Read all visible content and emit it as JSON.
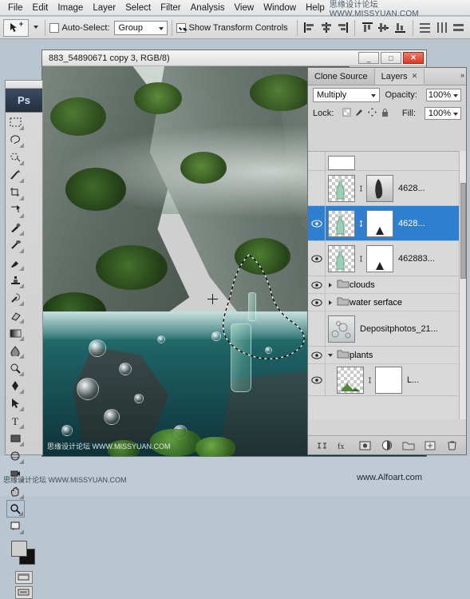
{
  "menubar": {
    "items": [
      "File",
      "Edit",
      "Image",
      "Layer",
      "Select",
      "Filter",
      "Analysis",
      "View",
      "Window",
      "Help"
    ],
    "watermark": "思缘设计论坛 WWW.MISSYUAN.COM"
  },
  "optionsbar": {
    "tool_icon": "move-tool-icon",
    "auto_select_label": "Auto-Select:",
    "auto_select_value": "Group",
    "show_transform_label": "Show Transform Controls",
    "align_icons": [
      "align-left-edges-icon",
      "align-horizontal-centers-icon",
      "align-right-edges-icon",
      "align-top-edges-icon",
      "align-vertical-centers-icon",
      "align-bottom-edges-icon"
    ],
    "distribute_icons": [
      "distribute-top-edges-icon",
      "distribute-vertical-centers-icon",
      "distribute-bottom-edges-icon"
    ]
  },
  "toolbox": {
    "app_badge": "Ps",
    "tools": [
      "marquee-tool-icon",
      "lasso-tool-icon",
      "quick-selection-tool-icon",
      "magic-wand-tool-icon",
      "crop-tool-icon",
      "slice-tool-icon",
      "eyedropper-tool-icon",
      "healing-brush-tool-icon",
      "brush-tool-icon",
      "stamp-tool-icon",
      "history-brush-tool-icon",
      "eraser-tool-icon",
      "gradient-tool-icon",
      "blur-tool-icon",
      "dodge-tool-icon",
      "pen-tool-icon",
      "type-tool-icon",
      "path-selection-tool-icon",
      "shape-tool-icon",
      "three-d-object-rotate-tool-icon",
      "three-d-camera-tool-icon",
      "hand-tool-icon",
      "zoom-tool-icon",
      "notes-tool-icon"
    ],
    "foreground_color": "#cfcfcf",
    "background_color": "#111111",
    "screen_mode_icons": [
      "standard-screen-mode-icon",
      "full-screen-mode-icon"
    ]
  },
  "document_window": {
    "title": "883_54890671 copy 3, RGB/8)",
    "minimize_label": "_",
    "maximize_label": "□",
    "close_label": "✕",
    "canvas_watermark": "思缘设计论坛 WWW.MISSYUAN.COM"
  },
  "panels": {
    "tabs": [
      {
        "label": "Clone Source",
        "active": false,
        "closable": false
      },
      {
        "label": "Layers",
        "active": true,
        "closable": true
      }
    ],
    "collapse_arrows": "»",
    "blend_mode": "Multiply",
    "opacity_label": "Opacity:",
    "opacity_value": "100%",
    "lock_label": "Lock:",
    "lock_icons": [
      "lock-transparent-pixels-icon",
      "lock-image-pixels-icon",
      "lock-position-icon",
      "lock-all-icon"
    ],
    "fill_label": "Fill:",
    "fill_value": "100%",
    "layers": [
      {
        "name": "",
        "kind": "partial-top",
        "visible": false,
        "selected": false,
        "thumb": "white",
        "mask": false
      },
      {
        "name": "4628...",
        "kind": "layer-with-mask",
        "visible": false,
        "selected": false,
        "thumb": "bottle",
        "mask": true,
        "mask_type": "gray"
      },
      {
        "name": "4628...",
        "kind": "layer-with-mask",
        "visible": true,
        "selected": true,
        "thumb": "bottle",
        "mask": true,
        "mask_type": "white-arrow"
      },
      {
        "name": "462883...",
        "kind": "layer-with-mask",
        "visible": true,
        "selected": false,
        "thumb": "bottle",
        "mask": true,
        "mask_type": "white-arrow"
      },
      {
        "name": "clouds",
        "kind": "group",
        "visible": true,
        "selected": false,
        "expanded": false
      },
      {
        "name": "water serface",
        "kind": "group",
        "visible": true,
        "selected": false,
        "expanded": false
      },
      {
        "name": "Depositphotos_21...",
        "kind": "layer",
        "visible": false,
        "selected": false,
        "thumb": "bubbles"
      },
      {
        "name": "plants",
        "kind": "group",
        "visible": true,
        "selected": false,
        "expanded": true
      },
      {
        "name": "L...",
        "kind": "layer-with-mask",
        "visible": true,
        "selected": false,
        "thumb": "plants",
        "mask": true,
        "mask_type": "white"
      }
    ],
    "footer_icons": [
      "link-layers-icon",
      "add-layer-style-icon",
      "add-layer-mask-icon",
      "new-fill-adjustment-layer-icon",
      "new-group-icon",
      "new-layer-icon",
      "delete-layer-icon"
    ]
  },
  "statusbar": {
    "watermark": "思缘设计论坛 WWW.MISSYUAN.COM",
    "site": "www.Alfoart.com"
  }
}
